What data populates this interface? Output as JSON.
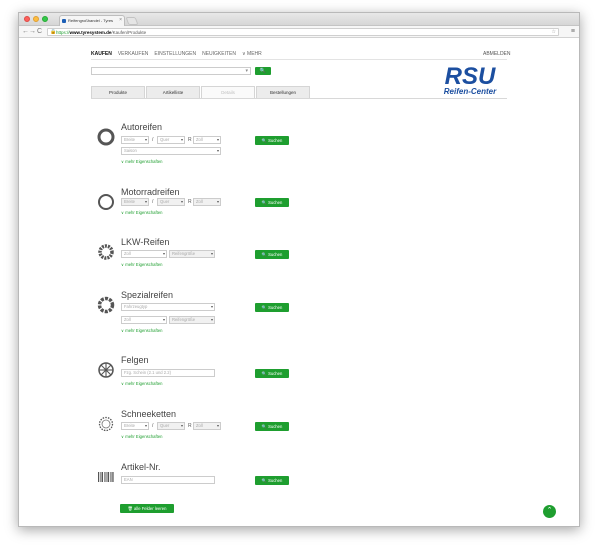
{
  "browser": {
    "tab_title": "Reifengroßhandel - Tyres",
    "tab_close": "×",
    "url_scheme": "https://",
    "url_host": "www.tyresystem.de",
    "url_path": "/Kaufen/Produkte",
    "back": "←",
    "forward": "→",
    "reload": "C",
    "menu": "≡",
    "lock": "🔒",
    "star": "☆"
  },
  "nav": {
    "items": [
      "KAUFEN",
      "VERKAUFEN",
      "EINSTELLUNGEN",
      "NEUIGKEITEN",
      "∨ MEHR"
    ],
    "logout": "ABMELDEN"
  },
  "search": {
    "button_icon": "🔍",
    "caret": "▾"
  },
  "logo": {
    "line1": "RSU",
    "line2": "Reifen-Center",
    "color": "#1c4fa0"
  },
  "tabs": [
    "Produkte",
    "Artikelliste",
    "Details",
    "Bestellungen"
  ],
  "sections": {
    "autoreifen": {
      "title": "Autoreifen",
      "breite": "Breite",
      "quer": "Quer",
      "zoll": "Zoll",
      "season": "Saison",
      "sep1": "/",
      "sep2": "R",
      "more": "∨ mehr Eigenschaften",
      "button": "🔍 Suchen"
    },
    "motorradreifen": {
      "title": "Motorradreifen",
      "breite": "Breite",
      "quer": "Quer",
      "zoll": "Zoll",
      "sep1": "/",
      "sep2": "R",
      "more": "∨ mehr Eigenschaften",
      "button": "🔍 Suchen"
    },
    "lkw": {
      "title": "LKW-Reifen",
      "zoll": "Zoll",
      "size": "Reifengröße",
      "more": "∨ mehr Eigenschaften",
      "button": "🔍 Suchen"
    },
    "spezial": {
      "title": "Spezialreifen",
      "type": "Fahrzeugtyp",
      "zoll": "Zoll",
      "size": "Reifengröße",
      "more": "∨ mehr Eigenschaften",
      "button": "🔍 Suchen"
    },
    "felgen": {
      "title": "Felgen",
      "placeholder": "Fzg. Schein (2.1 und 2.2)",
      "more": "∨ mehr Eigenschaften",
      "button": "🔍 Suchen"
    },
    "schneeketten": {
      "title": "Schneeketten",
      "breite": "Breite",
      "quer": "Quer",
      "zoll": "Zoll",
      "sep1": "/",
      "sep2": "R",
      "more": "∨ mehr Eigenschaften",
      "button": "🔍 Suchen"
    },
    "artikel": {
      "title": "Artikel-Nr.",
      "placeholder": "EAN",
      "button": "🔍 Suchen"
    }
  },
  "footer": {
    "clear": "🗑 alle Felder leeren",
    "top": "⌃"
  },
  "colors": {
    "accent": "#1e9e2f",
    "logo": "#1c4fa0"
  }
}
